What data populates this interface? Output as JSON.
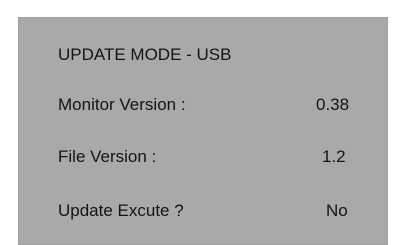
{
  "title": "UPDATE MODE - USB",
  "rows": [
    {
      "label": "Monitor Version :",
      "value": "0.38"
    },
    {
      "label": "File Version :",
      "value": "1.2"
    },
    {
      "label": "Update Excute ?",
      "value": "No"
    }
  ],
  "colors": {
    "panel_background": "#a9a9a9",
    "text": "#141414",
    "page_background": "#ffffff"
  }
}
